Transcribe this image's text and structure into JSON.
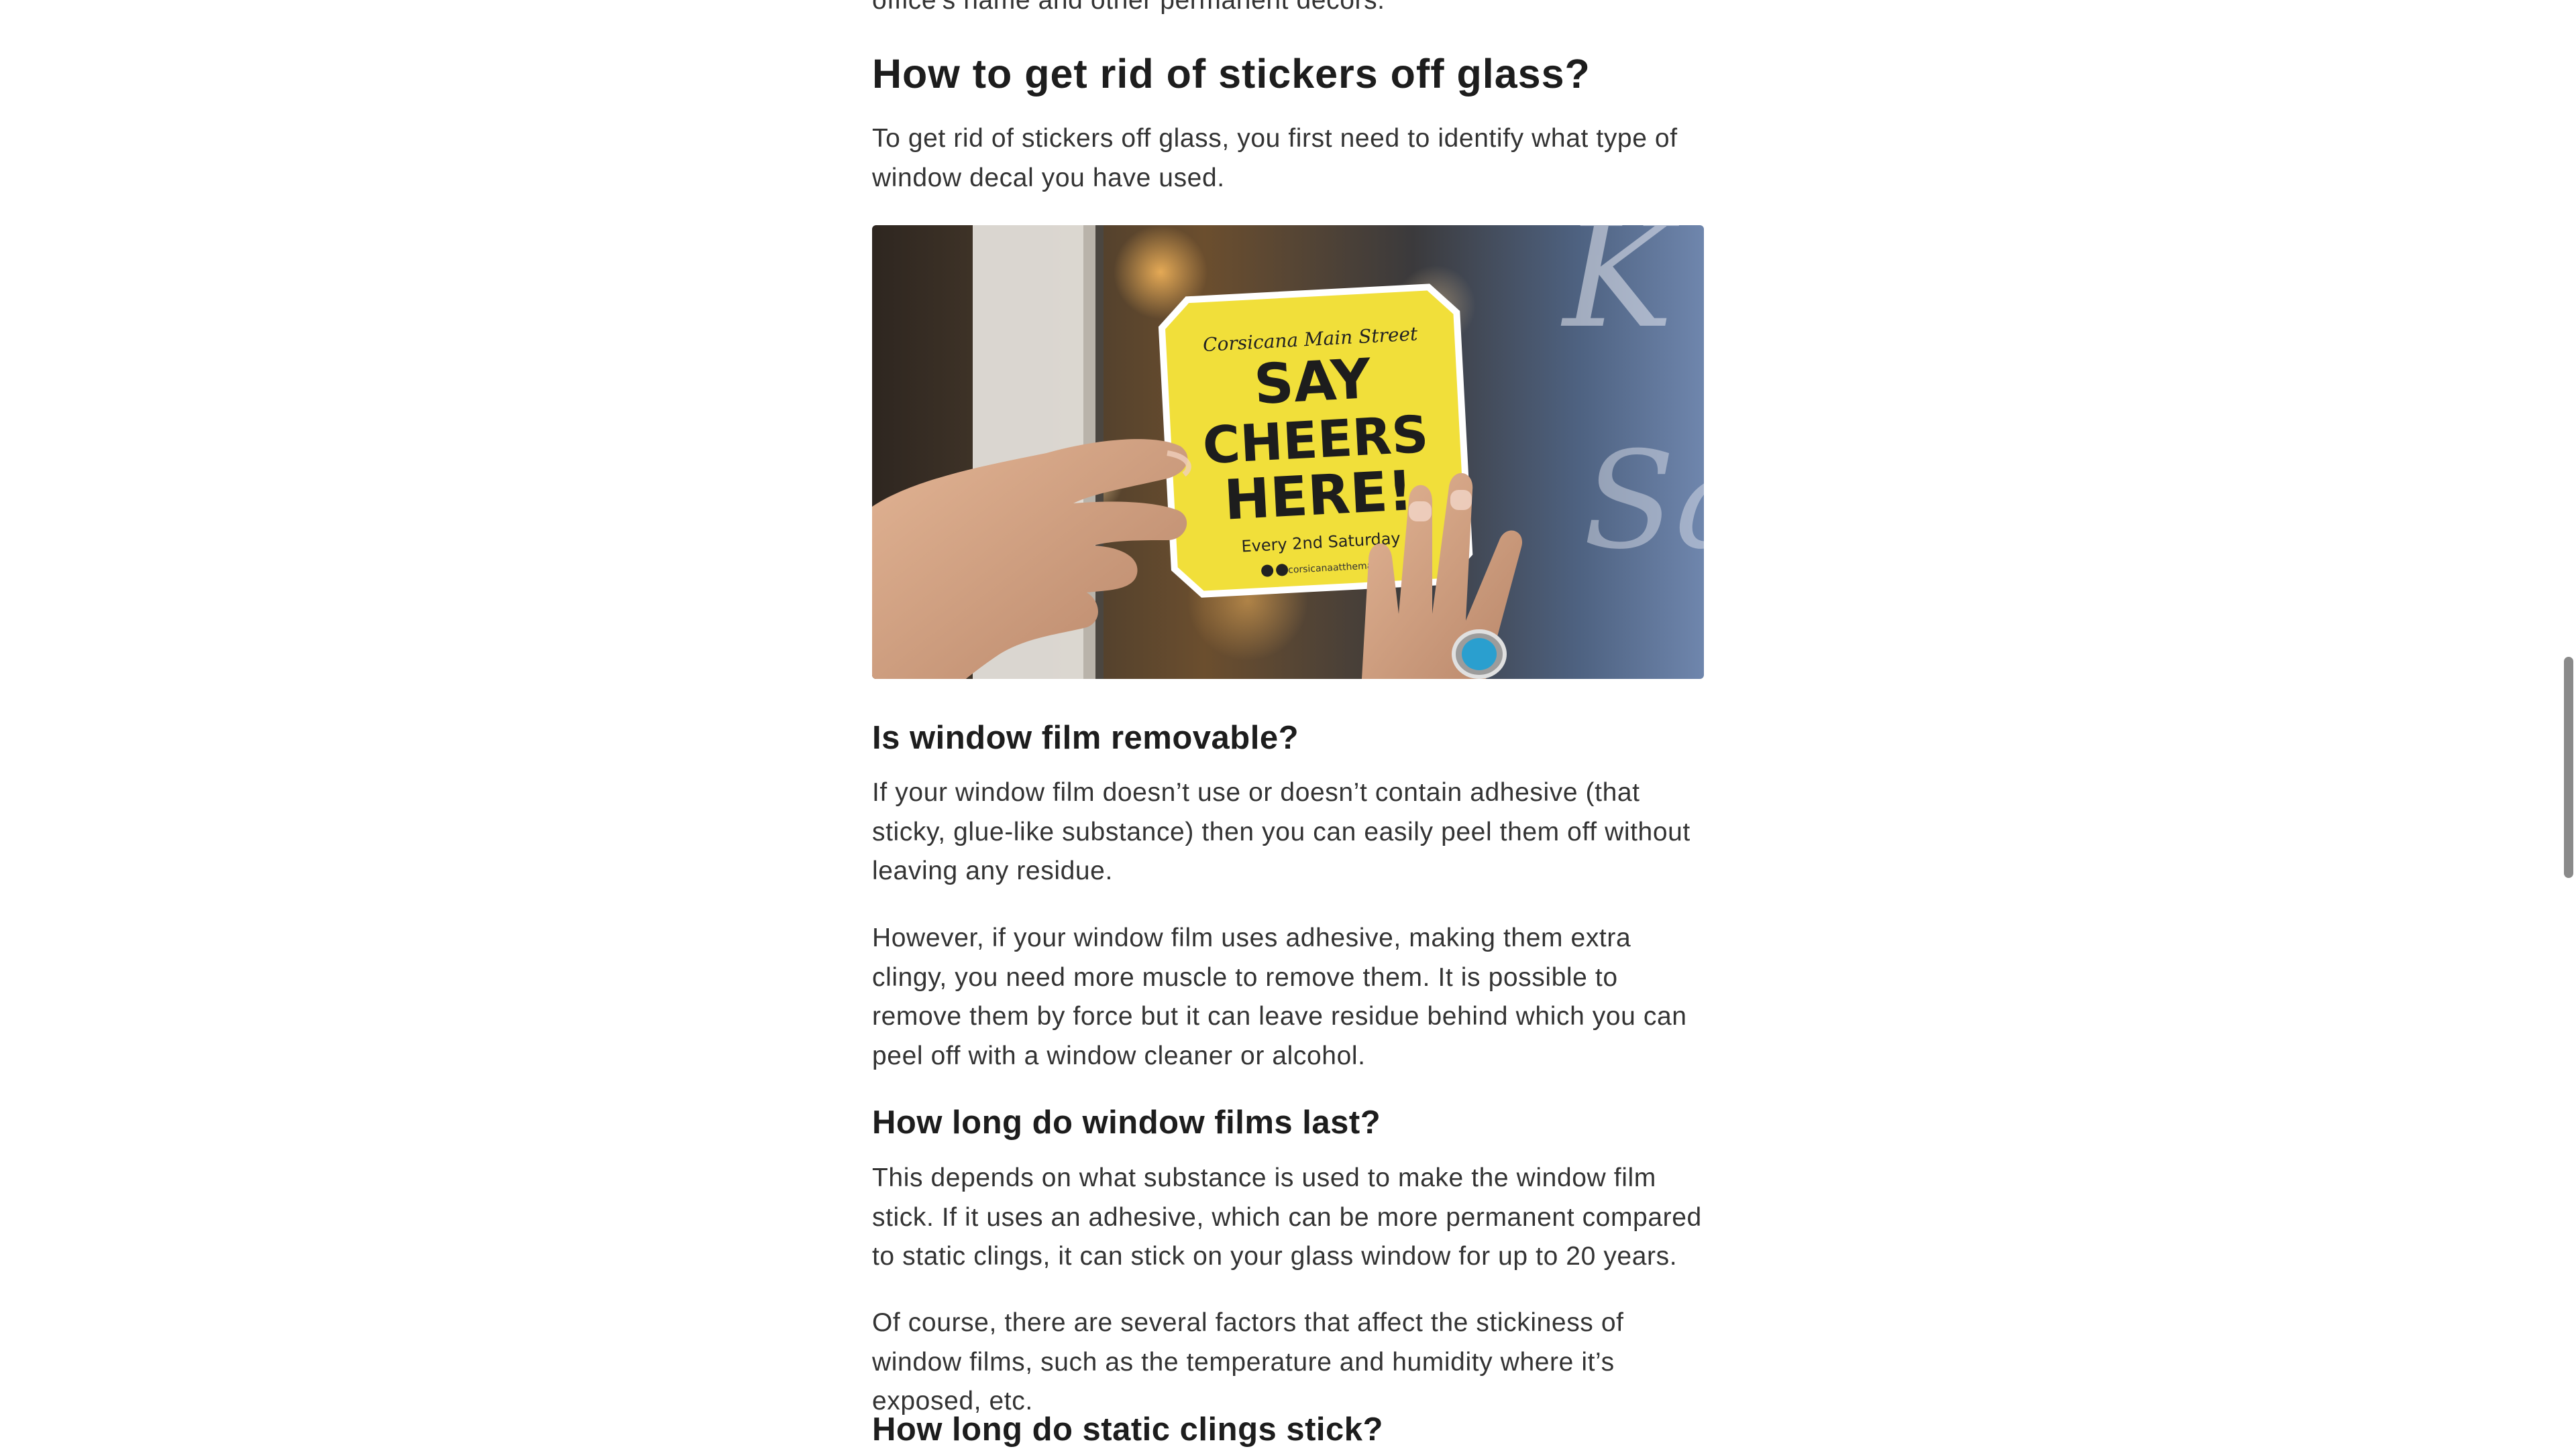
{
  "article": {
    "cut_line": "office’s name and other permanent decors.",
    "sections": [
      {
        "heading": "How to get rid of stickers off glass?",
        "intro": "To get rid of stickers off glass, you first need to identify what type of window decal you have used."
      },
      {
        "heading": "Is window film removable?",
        "paragraphs": [
          "If your window film doesn’t use or doesn’t contain adhesive (that sticky, glue-like substance) then you can easily peel them off without leaving any residue.",
          "However, if your window film uses adhesive, making them extra clingy, you need more muscle to remove them. It is possible to remove them by force but it can leave residue behind which you can peel off with a window cleaner or alcohol."
        ]
      },
      {
        "heading": "How long do window films last?",
        "paragraphs": [
          "This depends on what substance is used to make the window film stick. If it uses an adhesive, which can be more permanent compared to static clings, it can stick on your glass window for up to 20 years.",
          "Of course, there are several factors that affect the stickiness of window films, such as the temperature and humidity where it’s exposed, etc."
        ]
      },
      {
        "heading": "How long do static clings stick?"
      }
    ]
  },
  "photo": {
    "sticker": {
      "top_line": "Corsicana Main Street",
      "line1": "SAY",
      "line2": "CHEERS",
      "line3": "HERE!",
      "footer": "Every 2nd Saturday",
      "handle": "#corsicanaatthemarket"
    },
    "window_letters": [
      "K",
      "Sa"
    ],
    "colors": {
      "sticker": "#f1df3a",
      "ring_stone": "#2a9fcf"
    }
  }
}
